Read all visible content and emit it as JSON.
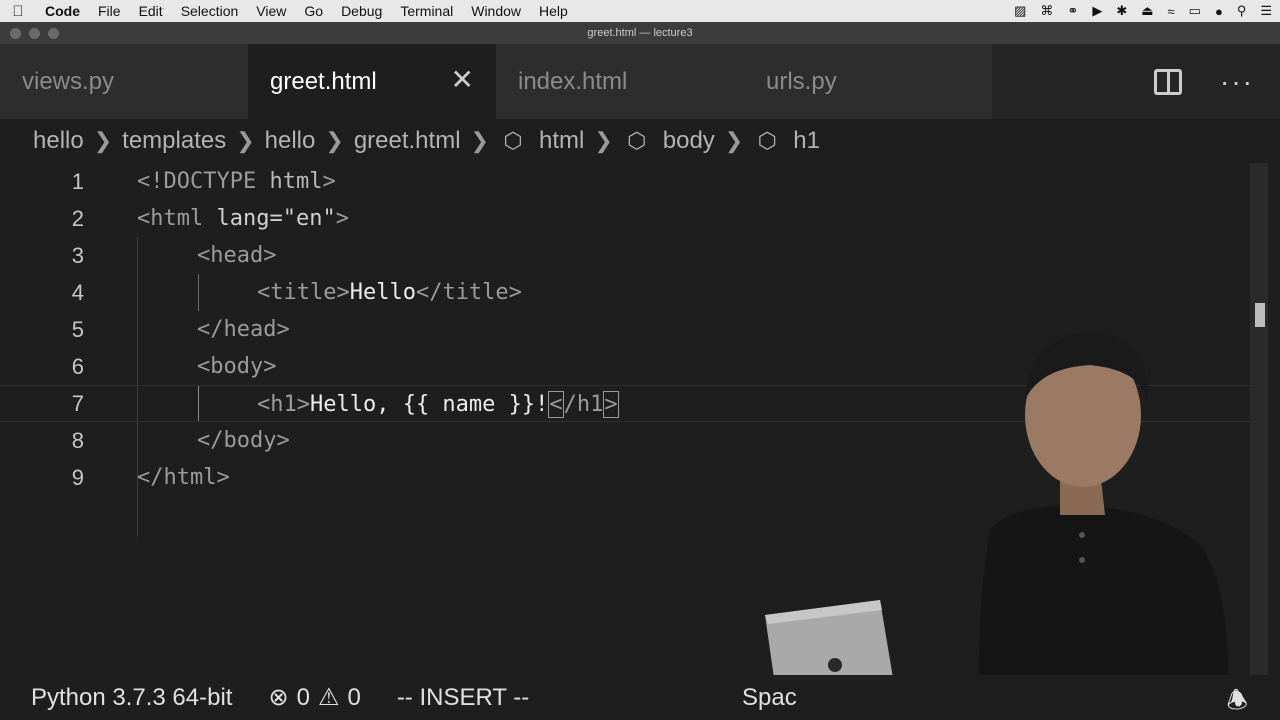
{
  "menubar": {
    "apple_icon": "apple-icon",
    "items": [
      "Code",
      "File",
      "Edit",
      "Selection",
      "View",
      "Go",
      "Debug",
      "Terminal",
      "Window",
      "Help"
    ],
    "status_icons": [
      "docker-icon",
      "command-icon",
      "glasses-icon",
      "play-icon",
      "bluetooth-icon",
      "eject-icon",
      "wifi-icon",
      "battery-icon",
      "user-icon",
      "search-icon",
      "list-icon"
    ]
  },
  "window": {
    "title": "greet.html — lecture3"
  },
  "tabs": [
    {
      "label": "views.py",
      "active": false
    },
    {
      "label": "greet.html",
      "active": true
    },
    {
      "label": "index.html",
      "active": false
    },
    {
      "label": "urls.py",
      "active": false
    }
  ],
  "breadcrumb": {
    "parts": [
      "hello",
      "templates",
      "hello",
      "greet.html"
    ],
    "symbols": [
      "html",
      "body",
      "h1"
    ]
  },
  "editor": {
    "lines": [
      {
        "num": "1",
        "indent": 0
      },
      {
        "num": "2",
        "indent": 0
      },
      {
        "num": "3",
        "indent": 1
      },
      {
        "num": "4",
        "indent": 2
      },
      {
        "num": "5",
        "indent": 1
      },
      {
        "num": "6",
        "indent": 1
      },
      {
        "num": "7",
        "indent": 2
      },
      {
        "num": "8",
        "indent": 1
      },
      {
        "num": "9",
        "indent": 0
      }
    ],
    "tokens": {
      "l1_open": "<!DOCTYPE",
      "l1_name": " html",
      "l1_close": ">",
      "l2_open": "<html",
      "l2_attr": " lang=",
      "l2_str": "\"en\"",
      "l2_close": ">",
      "l3": "<head>",
      "l4_open": "<title>",
      "l4_text": "Hello",
      "l4_close": "</title>",
      "l5": "</head>",
      "l6": "<body>",
      "l7_open": "<h1>",
      "l7_text": "Hello, {{ name }}!",
      "l7_lt": "<",
      "l7_close_name": "/h1",
      "l7_gt": ">",
      "l8": "</body>",
      "l9": "</html>"
    },
    "current_line": 7
  },
  "statusbar": {
    "python": "Python 3.7.3 64-bit",
    "errors": "0",
    "warnings": "0",
    "mode": "-- INSERT --",
    "spaces": "Spac"
  }
}
